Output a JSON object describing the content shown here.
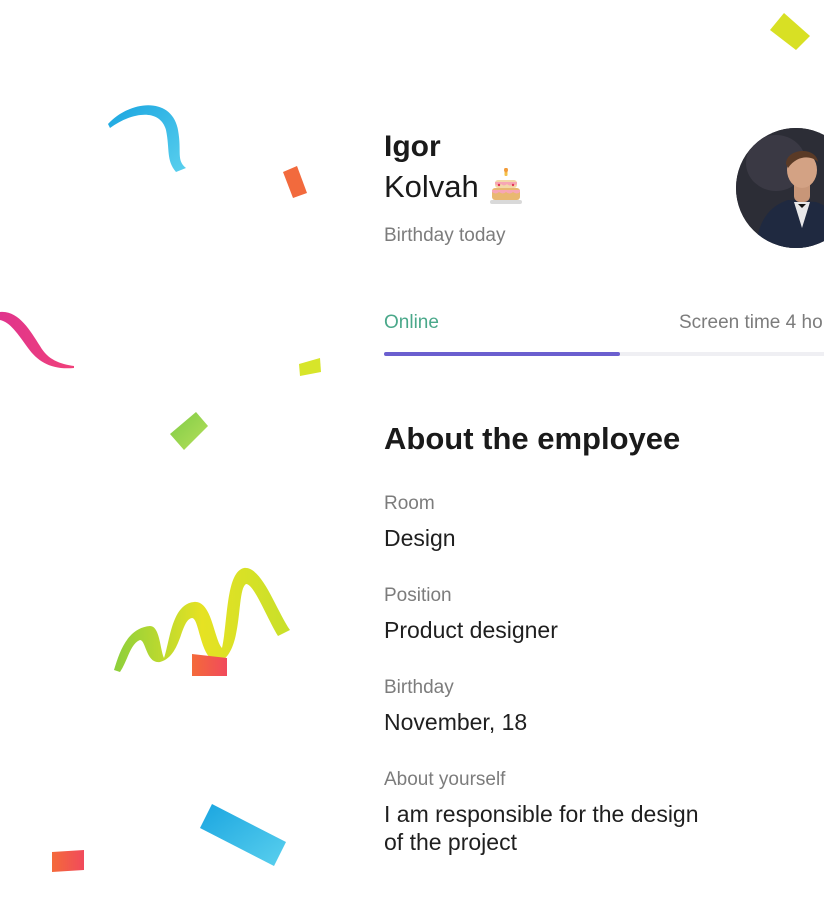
{
  "profile": {
    "first_name": "Igor",
    "last_name": "Kolvah",
    "subtitle": "Birthday today"
  },
  "tabs": [
    {
      "label": "Online",
      "active": true
    },
    {
      "label": "Screen time 4 ho"
    }
  ],
  "section_title": "About the employee",
  "fields": [
    {
      "label": "Room",
      "value": "Design"
    },
    {
      "label": "Position",
      "value": "Product designer"
    },
    {
      "label": "Birthday",
      "value": "November, 18"
    },
    {
      "label": "About yourself",
      "value_lines": [
        "I am responsible for the design",
        "of the project"
      ]
    }
  ],
  "colors": {
    "accent": "#6b5fcf",
    "online": "#4aa88a",
    "muted": "#7c7c7c"
  },
  "icons": {
    "cake": "birthday-cake-icon"
  }
}
